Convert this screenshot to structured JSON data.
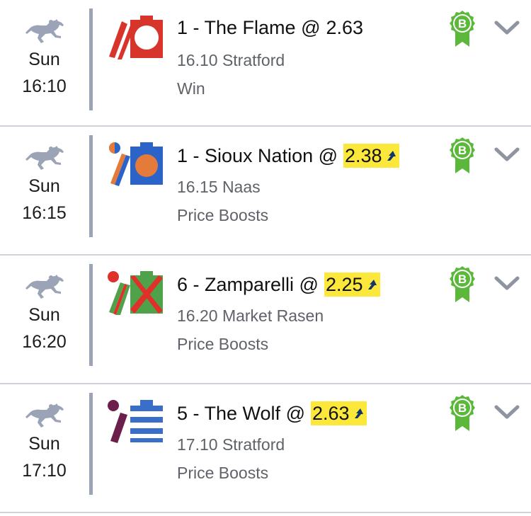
{
  "colors": {
    "boost_highlight": "#fbe83a",
    "divider": "#9aa4b6",
    "badge_green": "#5cb83b",
    "chevron": "#8f95a0",
    "horse_icon": "#9aa4b6",
    "arrow": "#12346b"
  },
  "icons": {
    "sport": "horse-racing-icon",
    "badge": "b-rosette-badge-icon",
    "expand": "chevron-down-icon",
    "boost": "price-boost-arrow-icon"
  },
  "bets": [
    {
      "day": "Sun",
      "time": "16:10",
      "selection": "1 - The Flame @",
      "odds": "2.63",
      "boosted": false,
      "race": "16.10 Stratford",
      "market": "Win",
      "badge": "B",
      "silk": "red-white-diamond-silks"
    },
    {
      "day": "Sun",
      "time": "16:15",
      "selection": "1 - Sioux Nation @",
      "odds": "2.38",
      "boosted": true,
      "race": "16.15 Naas",
      "market": "Price Boosts",
      "badge": "B",
      "silk": "blue-orange-disc-silks"
    },
    {
      "day": "Sun",
      "time": "16:20",
      "selection": "6 - Zamparelli @",
      "odds": "2.25",
      "boosted": true,
      "race": "16.20 Market Rasen",
      "market": "Price Boosts",
      "badge": "B",
      "silk": "green-red-cross-silks"
    },
    {
      "day": "Sun",
      "time": "17:10",
      "selection": "5 - The Wolf @",
      "odds": "2.63",
      "boosted": true,
      "race": "17.10 Stratford",
      "market": "Price Boosts",
      "badge": "B",
      "silk": "blue-white-hoops-silks"
    }
  ]
}
